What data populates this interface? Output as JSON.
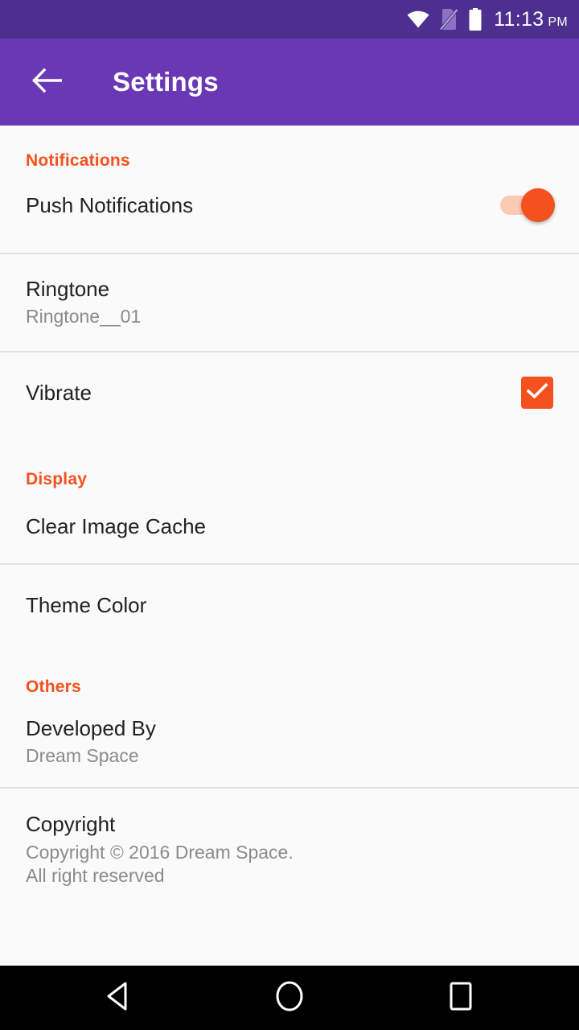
{
  "status_bar": {
    "time": "11:13",
    "ampm": "PM",
    "icons": [
      "wifi-icon",
      "no-sim-icon",
      "battery-icon"
    ]
  },
  "toolbar": {
    "title": "Settings",
    "back_icon": "arrow-back-icon",
    "background": "#6a38b5"
  },
  "colors": {
    "accent": "#f4511e",
    "toolbar_purple": "#6a38b5",
    "status_purple": "#4d2f8f",
    "page_background": "#fafafa",
    "divider": "#e2e2e2",
    "title_text": "#212121",
    "subtitle_text": "#8b8b8b"
  },
  "sections": [
    {
      "header": "Notifications",
      "rows": [
        {
          "title": "Push Notifications",
          "control": "toggle",
          "value": "on"
        },
        {
          "title": "Ringtone",
          "subtitle": "Ringtone__01",
          "control": "none"
        },
        {
          "title": "Vibrate",
          "control": "checkbox",
          "value": "checked"
        }
      ]
    },
    {
      "header": "Display",
      "rows": [
        {
          "title": "Clear Image Cache",
          "control": "none"
        },
        {
          "title": "Theme Color",
          "control": "none"
        }
      ]
    },
    {
      "header": "Others",
      "rows": [
        {
          "title": "Developed By",
          "subtitle": "Dream Space",
          "control": "none"
        },
        {
          "title": "Copyright",
          "subtitle": "Copyright © 2016 Dream Space.",
          "subtitle2": "All right reserved",
          "control": "none"
        }
      ]
    }
  ],
  "nav_bar": {
    "back_label": "back-triangle-icon",
    "home_label": "home-circle-icon",
    "recents_label": "recents-square-icon"
  }
}
